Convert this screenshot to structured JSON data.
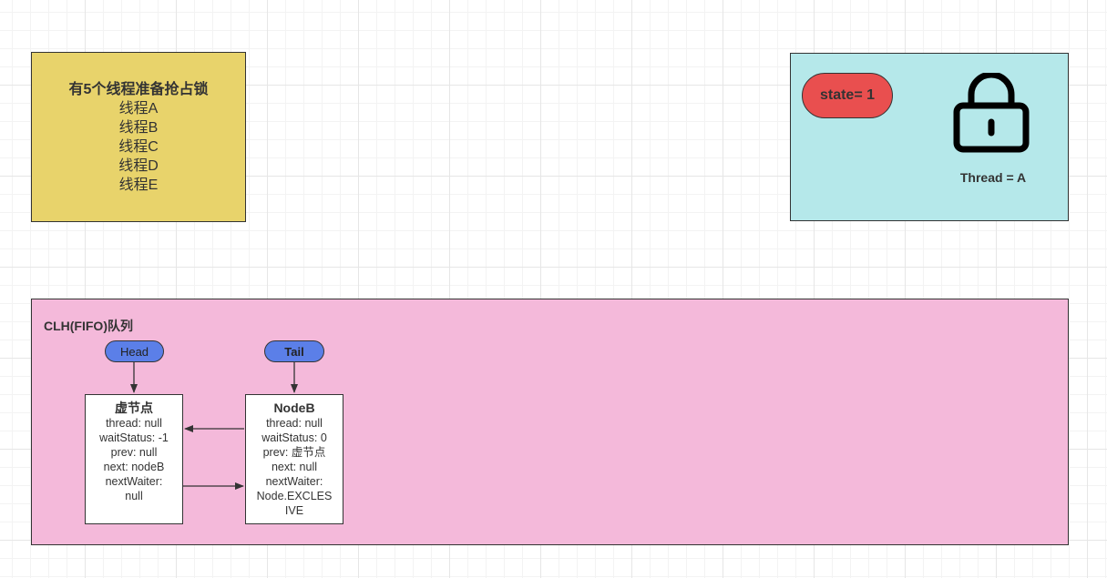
{
  "threads_box": {
    "title": "有5个线程准备抢占锁",
    "threads": [
      "线程A",
      "线程B",
      "线程C",
      "线程D",
      "线程E"
    ]
  },
  "lock_box": {
    "state": "state= 1",
    "owner": "Thread = A",
    "icon": "lock-icon"
  },
  "queue": {
    "title": "CLH(FIFO)队列",
    "head_label": "Head",
    "tail_label": "Tail",
    "nodes": [
      {
        "title": "虚节点",
        "lines": [
          "thread: null",
          "waitStatus: -1",
          "prev: null",
          "next: nodeB",
          "nextWaiter:",
          "null"
        ]
      },
      {
        "title": "NodeB",
        "lines": [
          "thread: null",
          "waitStatus: 0",
          "prev: 虚节点",
          "next: null",
          "nextWaiter:",
          "Node.EXCLES",
          "IVE"
        ]
      }
    ]
  },
  "colors": {
    "threads_box": "#e8d36b",
    "lock_box": "#b5e8ea",
    "state_pill": "#e94f4f",
    "queue_box": "#f4b9da",
    "pointer_pill": "#5b7fe8"
  }
}
